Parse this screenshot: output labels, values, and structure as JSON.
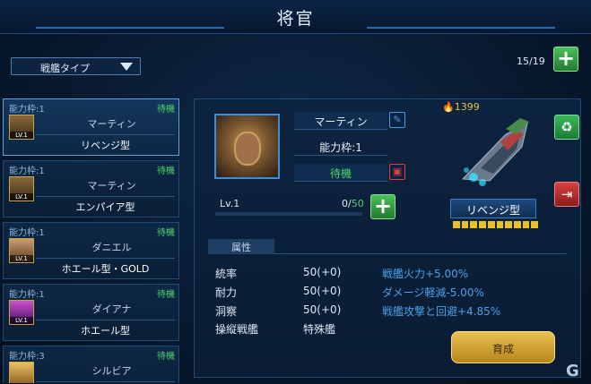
{
  "header": {
    "title": "将官"
  },
  "filter": {
    "label": "戦艦タイプ"
  },
  "counter": {
    "text": "15/19"
  },
  "officers": [
    {
      "slot": "能力枠:1",
      "status": "待機",
      "level": "LV.1",
      "name": "マーティン",
      "type": "リベンジ型"
    },
    {
      "slot": "能力枠:1",
      "status": "待機",
      "level": "LV.1",
      "name": "マーティン",
      "type": "エンパイア型"
    },
    {
      "slot": "能力枠:1",
      "status": "待機",
      "level": "LV.1",
      "name": "ダニエル",
      "type": "ホエール型・GOLD"
    },
    {
      "slot": "能力枠:1",
      "status": "待機",
      "level": "LV.1",
      "name": "ダイアナ",
      "type": "ホエール型"
    },
    {
      "slot": "能力枠:3",
      "status": "待機",
      "level": "",
      "name": "シルビア",
      "type": ""
    }
  ],
  "detail": {
    "name": "マーティン",
    "slot": "能力枠:1",
    "status": "待機",
    "level": "Lv.1",
    "exp_current": "0",
    "exp_max": "50",
    "exp_fraction": 0.0,
    "attr_tab": "属性",
    "attributes": [
      {
        "label": "統率",
        "value": "50(+0)"
      },
      {
        "label": "耐力",
        "value": "50(+0)"
      },
      {
        "label": "洞察",
        "value": "50(+0)"
      },
      {
        "label": "操縦戦艦",
        "value": "特殊艦"
      }
    ],
    "bonuses": [
      "戦艦火力+5.00%",
      "ダメージ軽減-5.00%",
      "戦艦攻撃と回避+4.85%"
    ],
    "gold": "1399",
    "ship_type": "リベンジ型",
    "train_label": "育成"
  },
  "icons": {
    "add": "plus-icon",
    "edit": "pencil-icon",
    "delete": "trash-icon",
    "recycle": "recycle-icon",
    "exit": "exit-icon",
    "gold": "flame-icon"
  },
  "colors": {
    "idle": "#4fd46a",
    "bonus": "#4aa0e8",
    "gold": "#e8c040"
  },
  "logo": "G"
}
